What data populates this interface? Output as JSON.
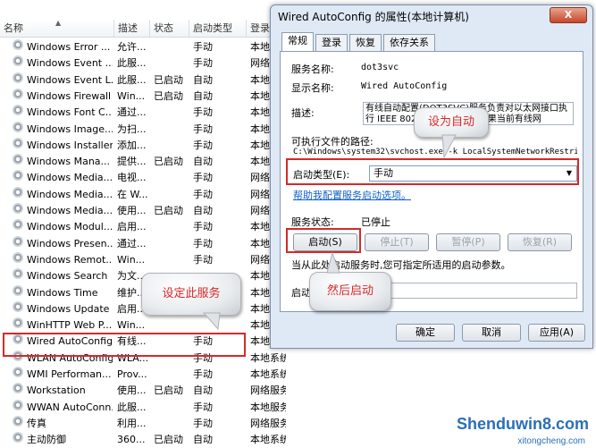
{
  "services": {
    "columns": [
      "名称",
      "描述",
      "状态",
      "启动类型",
      "登录"
    ],
    "rows": [
      {
        "name": "Windows Error ...",
        "desc": "允许...",
        "status": "",
        "startup": "手动",
        "logon": "本地"
      },
      {
        "name": "Windows Event ...",
        "desc": "此服...",
        "status": "",
        "startup": "手动",
        "logon": "网络"
      },
      {
        "name": "Windows Event L...",
        "desc": "此服...",
        "status": "已启动",
        "startup": "自动",
        "logon": "本地"
      },
      {
        "name": "Windows Firewall",
        "desc": "Win...",
        "status": "已启动",
        "startup": "自动",
        "logon": "本地"
      },
      {
        "name": "Windows Font C...",
        "desc": "通过...",
        "status": "",
        "startup": "手动",
        "logon": "本地"
      },
      {
        "name": "Windows Image...",
        "desc": "为扫...",
        "status": "",
        "startup": "手动",
        "logon": "本地"
      },
      {
        "name": "Windows Installer",
        "desc": "添加...",
        "status": "",
        "startup": "手动",
        "logon": "本地"
      },
      {
        "name": "Windows Mana...",
        "desc": "提供...",
        "status": "已启动",
        "startup": "自动",
        "logon": "本地"
      },
      {
        "name": "Windows Media...",
        "desc": "电视...",
        "status": "",
        "startup": "手动",
        "logon": "网络"
      },
      {
        "name": "Windows Media...",
        "desc": "在 W...",
        "status": "",
        "startup": "手动",
        "logon": "网络"
      },
      {
        "name": "Windows Media...",
        "desc": "使用...",
        "status": "已启动",
        "startup": "自动",
        "logon": "网络"
      },
      {
        "name": "Windows Modul...",
        "desc": "启用...",
        "status": "",
        "startup": "手动",
        "logon": "本地"
      },
      {
        "name": "Windows Presen...",
        "desc": "通过...",
        "status": "",
        "startup": "手动",
        "logon": "本地"
      },
      {
        "name": "Windows Remot...",
        "desc": "Win...",
        "status": "",
        "startup": "手动",
        "logon": "网络"
      },
      {
        "name": "Windows Search",
        "desc": "为文...",
        "status": "",
        "startup": "",
        "logon": "本地"
      },
      {
        "name": "Windows Time",
        "desc": "维护...",
        "status": "",
        "startup": "",
        "logon": "本地"
      },
      {
        "name": "Windows Update",
        "desc": "启用...",
        "status": "",
        "startup": "",
        "logon": "本地"
      },
      {
        "name": "WinHTTP Web P...",
        "desc": "Win...",
        "status": "",
        "startup": "",
        "logon": "本地"
      },
      {
        "name": "Wired AutoConfig",
        "desc": "有线...",
        "status": "",
        "startup": "手动",
        "logon": "本地"
      },
      {
        "name": "WLAN AutoConfig",
        "desc": "WLA...",
        "status": "",
        "startup": "手动",
        "logon": "本地系统"
      },
      {
        "name": "WMI Performan...",
        "desc": "Prov...",
        "status": "",
        "startup": "手动",
        "logon": "本地系统"
      },
      {
        "name": "Workstation",
        "desc": "使用...",
        "status": "已启动",
        "startup": "自动",
        "logon": "网络服务"
      },
      {
        "name": "WWAN AutoConn...",
        "desc": "此服...",
        "status": "",
        "startup": "手动",
        "logon": "本地服务"
      },
      {
        "name": "传真",
        "desc": "利用...",
        "status": "",
        "startup": "手动",
        "logon": "网络服务"
      },
      {
        "name": "主动防御",
        "desc": "360...",
        "status": "已启动",
        "startup": "自动",
        "logon": "本地系统"
      }
    ]
  },
  "dialog": {
    "title": "Wired AutoConfig 的属性(本地计算机)",
    "close": "X",
    "tabs": [
      "常规",
      "登录",
      "恢复",
      "依存关系"
    ],
    "service_name_label": "服务名称:",
    "service_name": "dot3svc",
    "display_name_label": "显示名称:",
    "display_name": "Wired AutoConfig",
    "desc_label": "描述:",
    "desc": "有线自动配置(DOT3SVC)服务负责对以太网接口执行 IEEE 802.1X 身份验证。如果当前有线网",
    "path_label": "可执行文件的路径:",
    "path": "C:\\Windows\\system32\\svchost.exe -k LocalSystemNetworkRestric",
    "startup_label": "启动类型(E):",
    "startup_value": "手动",
    "help_link": "帮助我配置服务启动选项。",
    "status_label": "服务状态:",
    "status_value": "已停止",
    "start_btn": "启动(S)",
    "stop_btn": "停止(T)",
    "pause_btn": "暂停(P)",
    "resume_btn": "恢复(R)",
    "hint": "当从此处启动服务时,您可指定所适用的启动参数。",
    "param_label": "启动参",
    "ok": "确定",
    "cancel": "取消",
    "apply": "应用(A)"
  },
  "callouts": {
    "set_auto": "设为自动",
    "set_service": "设定此服务",
    "then_start": "然后启动"
  },
  "watermark": {
    "main": "Shenduwin8.com",
    "sub": "xitongcheng.com"
  }
}
